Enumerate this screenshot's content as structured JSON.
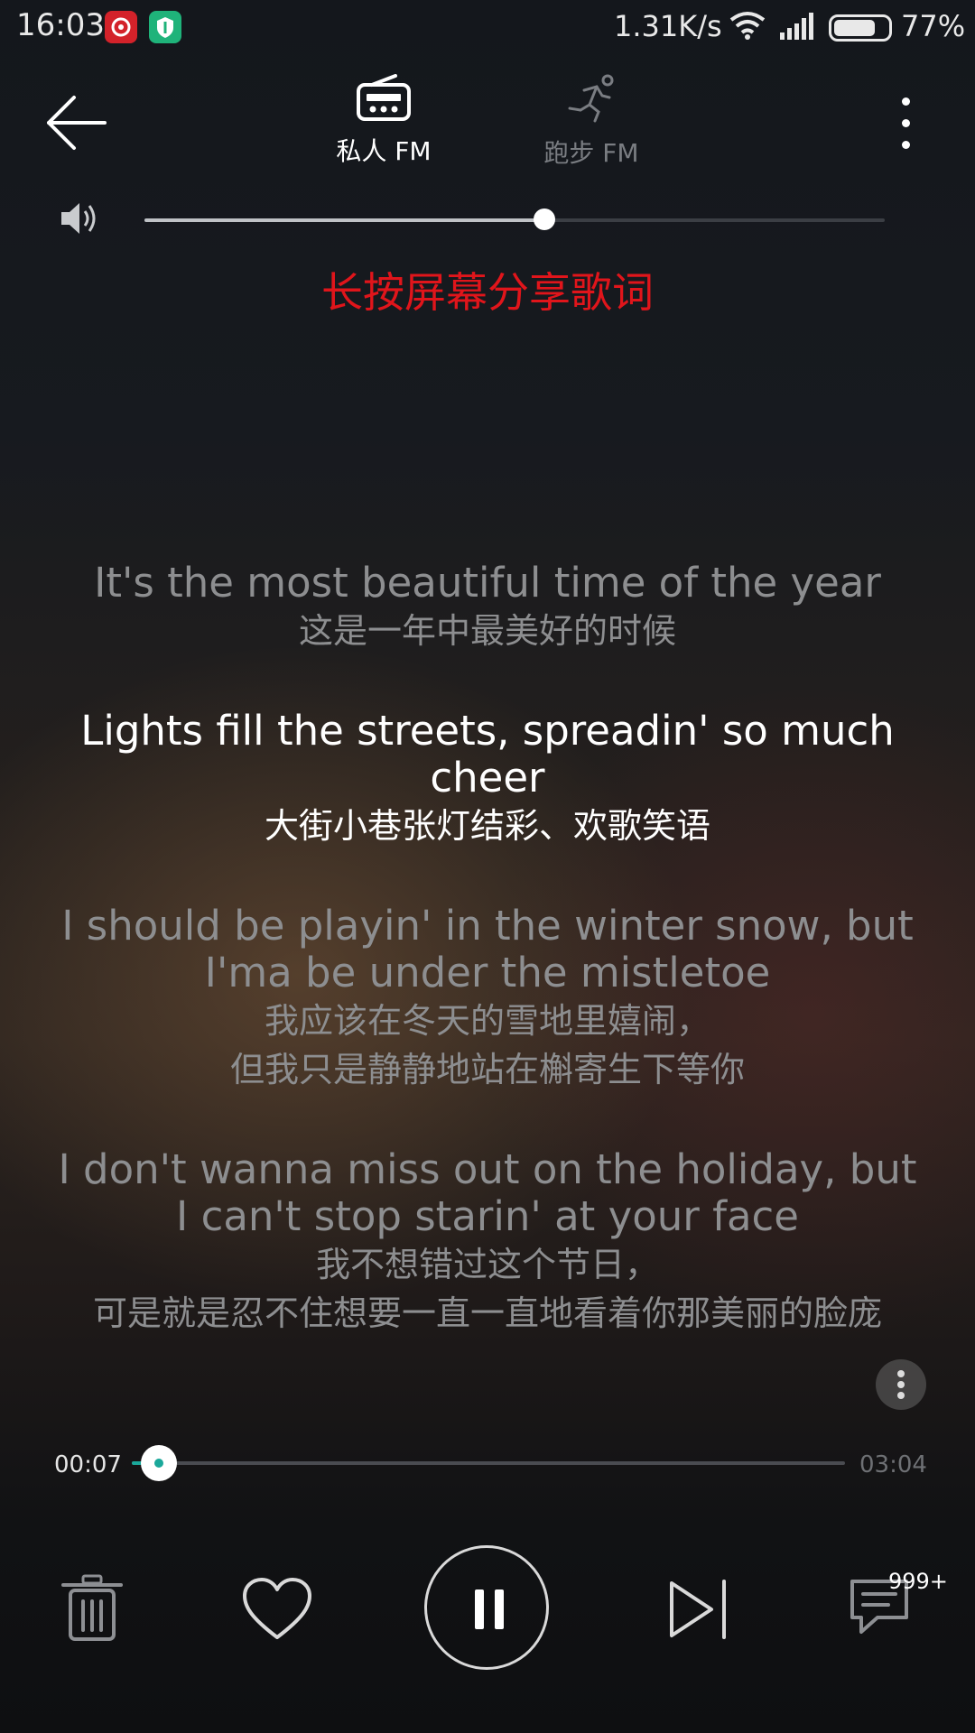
{
  "status_bar": {
    "time": "16:03",
    "net_speed": "1.31K/s",
    "battery_percent": "77%",
    "battery_level": 0.77
  },
  "header": {
    "tabs": [
      {
        "label": "私人 FM",
        "icon": "radio-icon",
        "active": true
      },
      {
        "label": "跑步 FM",
        "icon": "running-icon",
        "active": false
      }
    ]
  },
  "volume": {
    "level": 0.54
  },
  "share_tip": "长按屏幕分享歌词",
  "lyrics": [
    {
      "en": "It's the most beautiful time of the year",
      "zh": "这是一年中最美好的时候",
      "active": false
    },
    {
      "en": "Lights fill the streets, spreadin' so much cheer",
      "zh": "大街小巷张灯结彩、欢歌笑语",
      "active": true
    },
    {
      "en": "I should be playin' in the winter snow, but I'ma be under the mistletoe",
      "zh": "我应该在冬天的雪地里嬉闹，\n但我只是静静地站在槲寄生下等你",
      "active": false
    },
    {
      "en": "I don't wanna miss out on the holiday, but I can't stop starin' at your face",
      "zh": "我不想错过这个节日，\n可是就是忍不住想要一直一直地看着你那美丽的脸庞",
      "active": false
    }
  ],
  "progress": {
    "current": "00:07",
    "total": "03:04",
    "fraction": 0.038
  },
  "controls": {
    "comment_badge": "999+"
  },
  "colors": {
    "accent": "#1aa89a",
    "share_tip": "#e0151b"
  }
}
